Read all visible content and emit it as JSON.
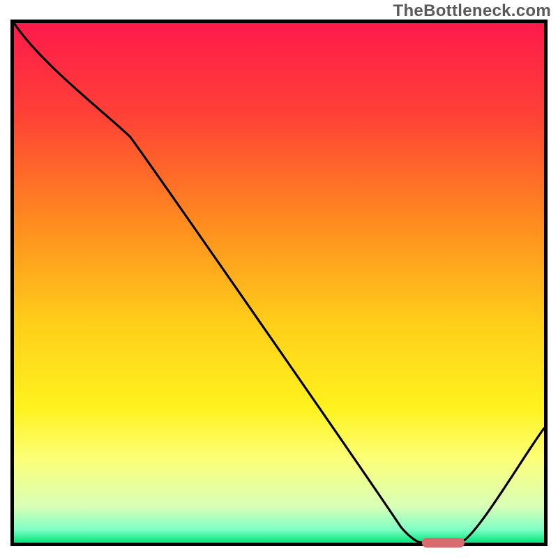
{
  "watermark": "TheBottleneck.com",
  "chart_data": {
    "type": "line",
    "title": "",
    "xlabel": "",
    "ylabel": "",
    "xlim": [
      0,
      100
    ],
    "ylim": [
      0,
      100
    ],
    "grid": false,
    "legend": false,
    "curve": {
      "x": [
        0,
        22,
        73,
        77,
        84,
        100
      ],
      "y": [
        100,
        78,
        3,
        0,
        0,
        22
      ]
    },
    "gradient_stops": [
      {
        "pos": 0.0,
        "color": "#ff1a4b"
      },
      {
        "pos": 0.18,
        "color": "#ff4236"
      },
      {
        "pos": 0.38,
        "color": "#ff8a1f"
      },
      {
        "pos": 0.58,
        "color": "#ffcf1a"
      },
      {
        "pos": 0.74,
        "color": "#fff21e"
      },
      {
        "pos": 0.84,
        "color": "#fcff79"
      },
      {
        "pos": 0.93,
        "color": "#d9ffb7"
      },
      {
        "pos": 0.975,
        "color": "#7fffc4"
      },
      {
        "pos": 1.0,
        "color": "#00e47a"
      }
    ],
    "marker": {
      "x_start": 77,
      "x_end": 85,
      "y": 0,
      "color": "#d86b6f"
    }
  }
}
